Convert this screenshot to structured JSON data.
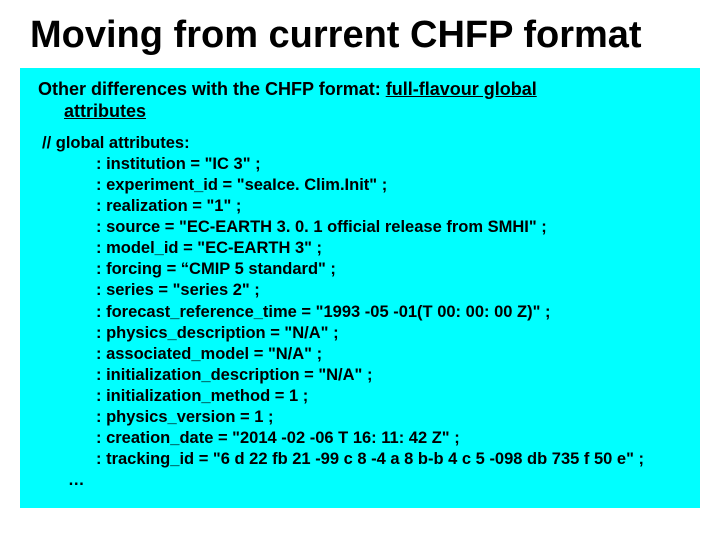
{
  "title": "Moving from current CHFP format",
  "subhead_prefix": "Other differences with the CHFP format: ",
  "subhead_under_part1": "full-flavour global",
  "subhead_under_part2": "attributes",
  "code": {
    "comment": "// global attributes:",
    "lines": [
      ": institution = \"IC 3\" ;",
      ": experiment_id = \"seaIce. Clim.Init\" ;",
      ": realization = \"1\" ;",
      ": source = \"EC-EARTH 3. 0. 1 official release from SMHI\" ;",
      ": model_id = \"EC-EARTH 3\" ;",
      ": forcing = “CMIP 5 standard\" ;",
      ": series = \"series 2\" ;",
      ": forecast_reference_time = \"1993 -05 -01(T 00: 00: 00 Z)\" ;",
      ": physics_description = \"N/A\" ;",
      ": associated_model = \"N/A\" ;",
      ": initialization_description = \"N/A\" ;",
      ": initialization_method = 1 ;",
      ": physics_version = 1 ;",
      ": creation_date = \"2014 -02 -06 T 16: 11: 42 Z\" ;",
      ": tracking_id = \"6 d 22 fb 21 -99 c 8 -4 a 8 b-b 4 c 5 -098 db 735 f 50 e\" ;"
    ],
    "ellipsis": "…"
  }
}
